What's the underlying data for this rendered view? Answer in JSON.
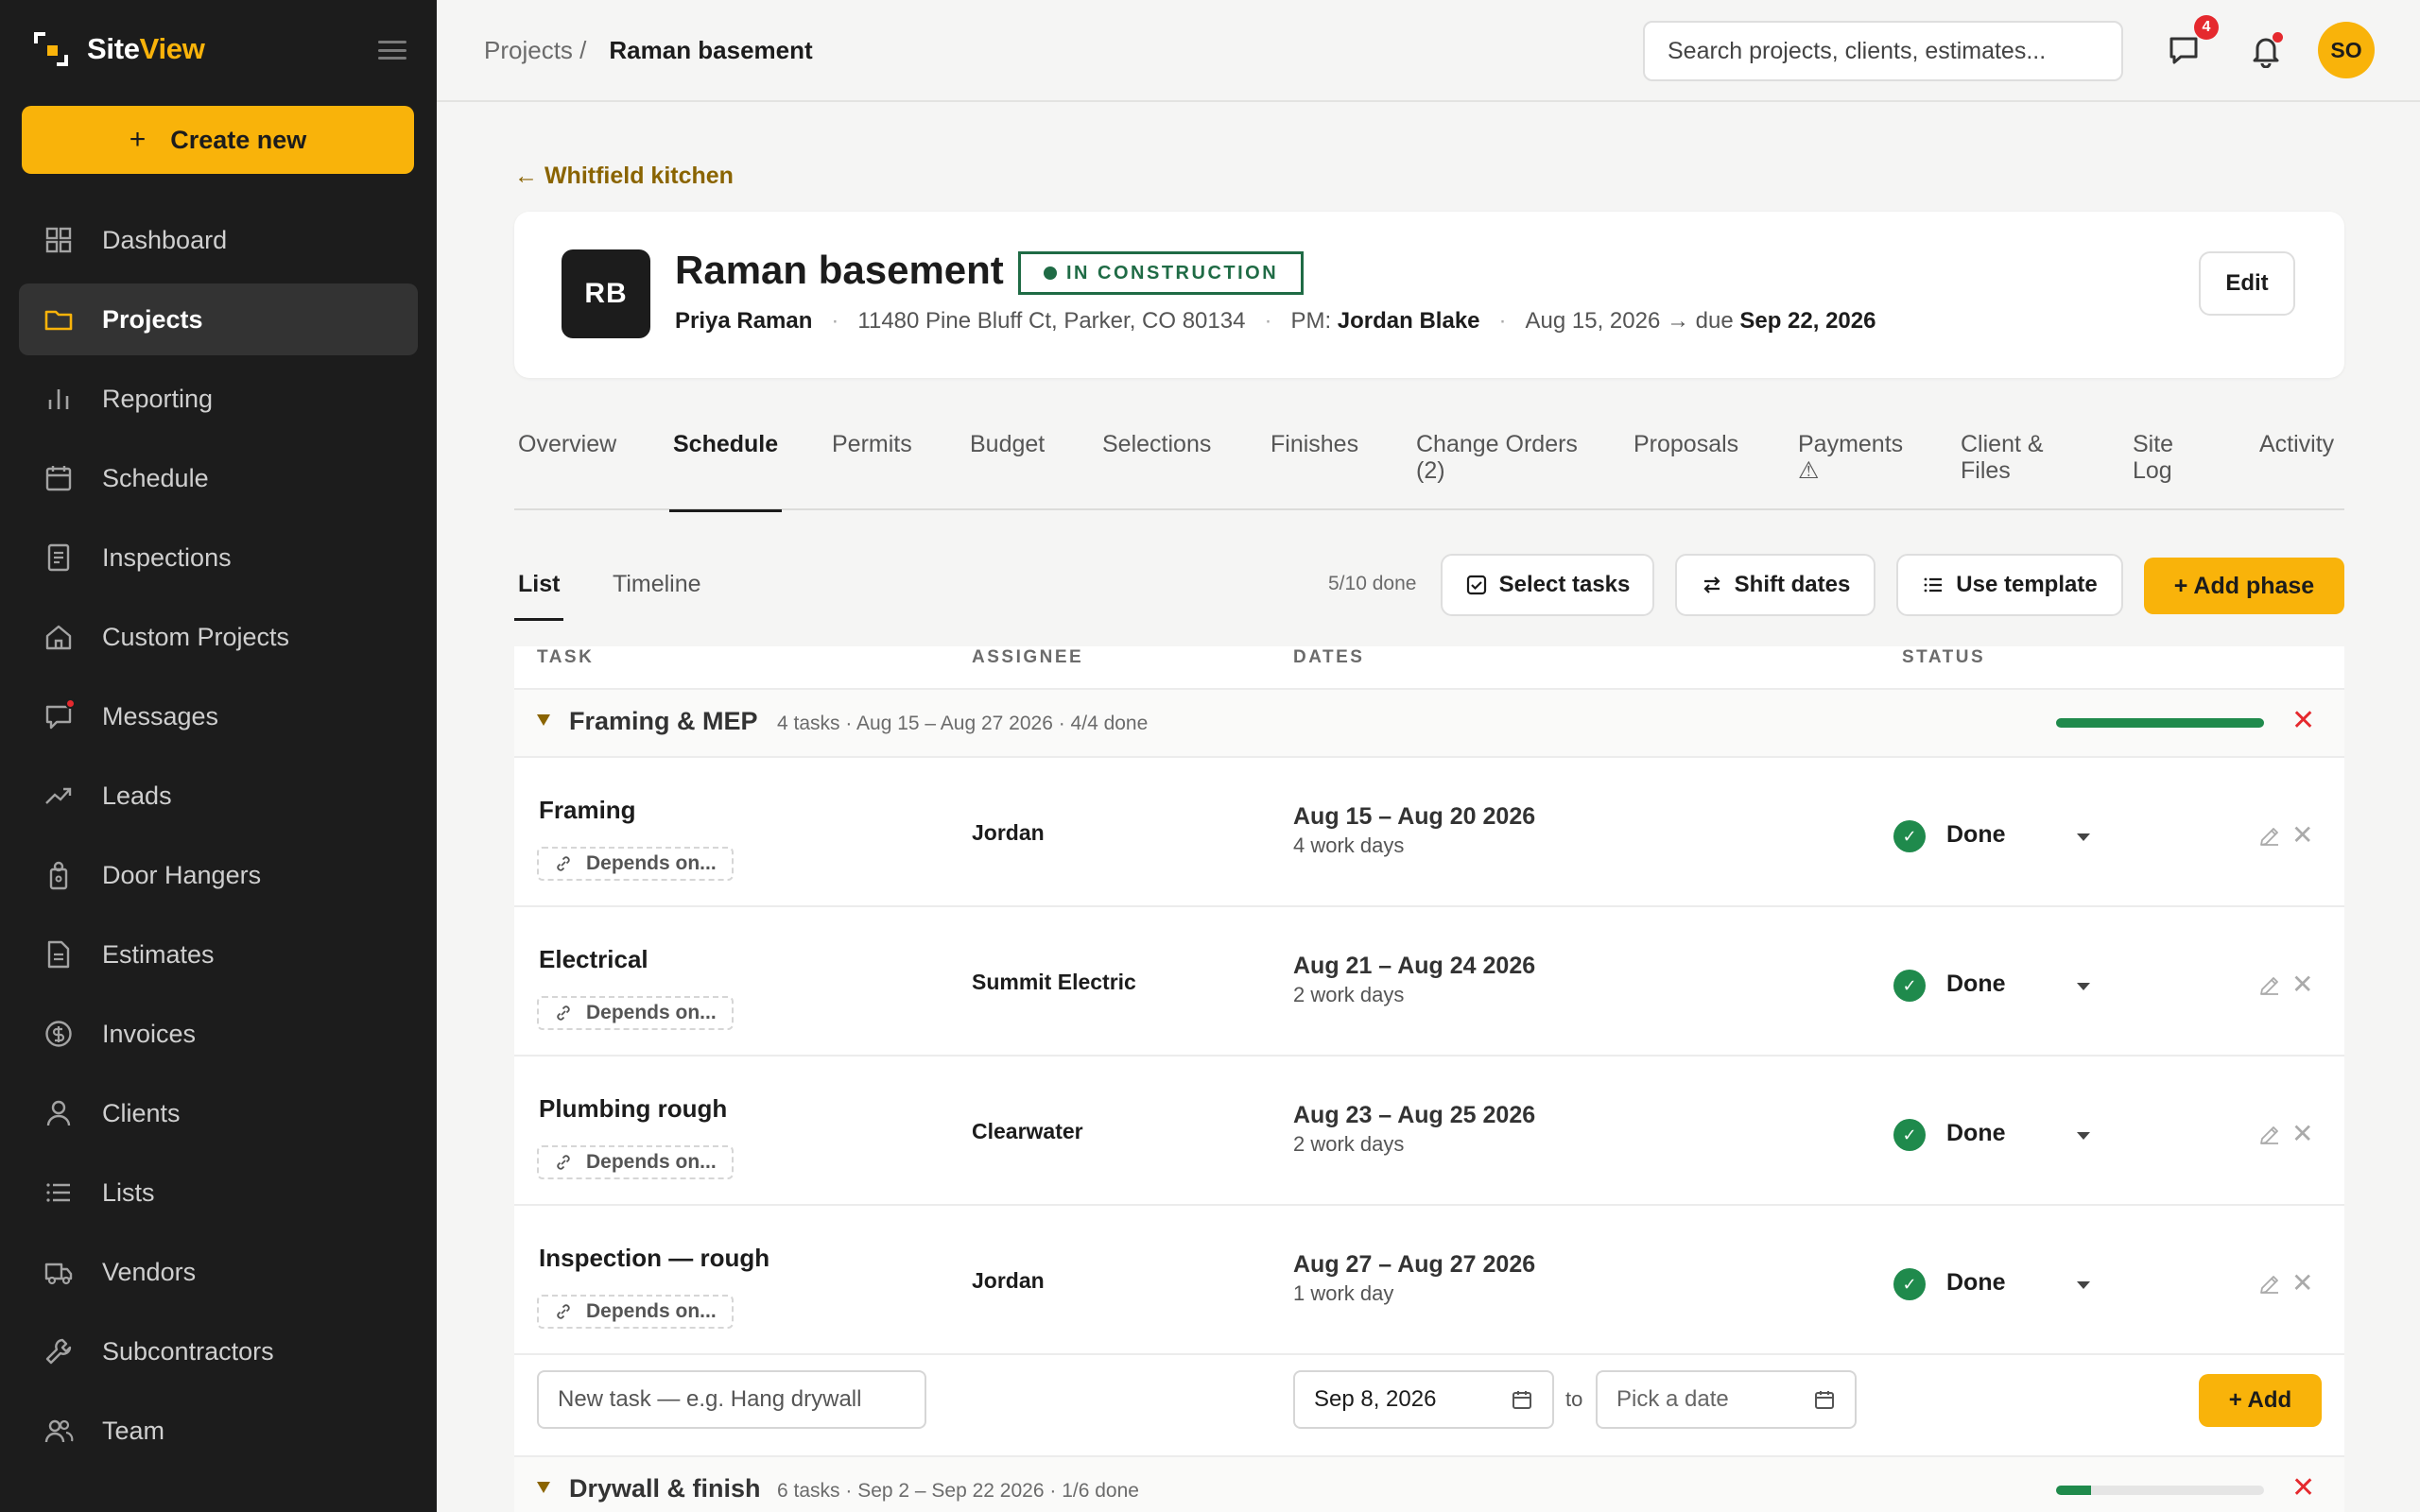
{
  "app": {
    "brand_part1": "Site",
    "brand_part2": "View",
    "create_label": "Create new",
    "create_plus": "+"
  },
  "nav": [
    {
      "label": "Dashboard",
      "icon": "dashboard-icon",
      "active": false
    },
    {
      "label": "Projects",
      "icon": "folder-icon",
      "active": true
    },
    {
      "label": "Reporting",
      "icon": "bar-chart-icon",
      "active": false
    },
    {
      "label": "Schedule",
      "icon": "calendar-icon",
      "active": false
    },
    {
      "label": "Inspections",
      "icon": "document-icon",
      "active": false
    },
    {
      "label": "Custom Projects",
      "icon": "home-icon",
      "active": false
    },
    {
      "label": "Messages",
      "icon": "message-icon",
      "active": false,
      "has_dot": true
    },
    {
      "label": "Leads",
      "icon": "trend-icon",
      "active": false
    },
    {
      "label": "Door Hangers",
      "icon": "door-hanger-icon",
      "active": false
    },
    {
      "label": "Estimates",
      "icon": "file-icon",
      "active": false
    },
    {
      "label": "Invoices",
      "icon": "dollar-icon",
      "active": false
    },
    {
      "label": "Clients",
      "icon": "user-icon",
      "active": false
    },
    {
      "label": "Lists",
      "icon": "list-icon",
      "active": false
    },
    {
      "label": "Vendors",
      "icon": "truck-icon",
      "active": false
    },
    {
      "label": "Subcontractors",
      "icon": "wrench-icon",
      "active": false
    },
    {
      "label": "Team",
      "icon": "team-icon",
      "active": false
    }
  ],
  "topbar": {
    "crumb_parent": "Projects /",
    "crumb_current": "Raman basement",
    "search_placeholder": "Search projects, clients, estimates...",
    "messages_badge": "4",
    "user_initials": "SO"
  },
  "project": {
    "back_label": "← Whitfield kitchen",
    "initials": "RB",
    "title": "Raman basement",
    "status": "IN CONSTRUCTION",
    "client": "Priya Raman",
    "address": "11480 Pine Bluff Ct, Parker, CO 80134",
    "pm_label": "PM:",
    "pm_name": "Jordan Blake",
    "dates_prefix": "Aug 15, 2026 → due",
    "due_date": "Sep 22, 2026",
    "sep": "·",
    "edit_label": "Edit"
  },
  "tabs": [
    {
      "label": "Overview",
      "active": false
    },
    {
      "label": "Schedule",
      "active": true
    },
    {
      "label": "Permits",
      "active": false
    },
    {
      "label": "Budget",
      "active": false
    },
    {
      "label": "Selections",
      "active": false
    },
    {
      "label": "Finishes",
      "active": false
    },
    {
      "label": "Change Orders (2)",
      "active": false
    },
    {
      "label": "Proposals",
      "active": false
    },
    {
      "label": "Payments ⚠",
      "active": false
    },
    {
      "label": "Client & Files",
      "active": false
    },
    {
      "label": "Site Log",
      "active": false
    },
    {
      "label": "Activity",
      "active": false
    }
  ],
  "schedule": {
    "view_list": "List",
    "view_timeline": "Timeline",
    "done_count": "5/10 done",
    "select_tasks": "Select tasks",
    "shift_dates": "Shift dates",
    "use_template": "Use template",
    "add_phase": "+ Add phase",
    "columns": [
      "TASK",
      "ASSIGNEE",
      "DATES",
      "STATUS"
    ]
  },
  "phases": [
    {
      "name": "Framing & MEP",
      "meta": "4 tasks · Aug 15 – Aug 27 2026 · 4/4 done",
      "progress": 1.0,
      "tasks": [
        {
          "name": "Framing",
          "depends": "Depends on...",
          "assignee": "Jordan",
          "dates": "Aug 15 – Aug 20 2026",
          "workdays": "4 work days",
          "status": "Done"
        },
        {
          "name": "Electrical",
          "depends": "Depends on...",
          "assignee": "Summit Electric",
          "dates": "Aug 21 – Aug 24 2026",
          "workdays": "2 work days",
          "status": "Done"
        },
        {
          "name": "Plumbing rough",
          "depends": "Depends on...",
          "assignee": "Clearwater",
          "dates": "Aug 23 – Aug 25 2026",
          "workdays": "2 work days",
          "status": "Done"
        },
        {
          "name": "Inspection — rough",
          "depends": "Depends on...",
          "assignee": "Jordan",
          "dates": "Aug 27 – Aug 27 2026",
          "workdays": "1 work day",
          "status": "Done"
        }
      ]
    },
    {
      "name": "Drywall & finish",
      "meta": "6 tasks · Sep 2 – Sep 22 2026 · 1/6 done",
      "progress": 0.1667,
      "tasks": []
    }
  ],
  "new_task": {
    "placeholder": "New task — e.g. Hang drywall",
    "start_date": "Sep 8, 2026",
    "to_label": "to",
    "end_placeholder": "Pick a date",
    "add_label": "+ Add"
  }
}
